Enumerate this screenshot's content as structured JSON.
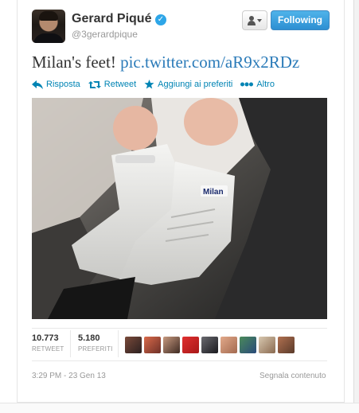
{
  "tweet": {
    "user": {
      "display_name": "Gerard Piqué",
      "screen_name": "@3gerardpique",
      "verified": true
    },
    "buttons": {
      "follow_label": "Following",
      "user_menu_icon": "user-dropdown-icon"
    },
    "text": {
      "body": "Milan's feet!",
      "link": "pic.twitter.com/aR9x2RDz"
    },
    "actions": [
      {
        "label": "Risposta",
        "icon": "reply-icon"
      },
      {
        "label": "Retweet",
        "icon": "retweet-icon"
      },
      {
        "label": "Aggiungi ai preferiti",
        "icon": "star-icon"
      },
      {
        "label": "Altro",
        "icon": "more-icon"
      }
    ],
    "stats": {
      "retweets": {
        "value": "10.773",
        "label": "RETWEET"
      },
      "favorites": {
        "value": "5.180",
        "label": "PREFERITI"
      }
    },
    "timestamp": "3:29 PM - 23 Gen 13",
    "report_label": "Segnala contenuto"
  },
  "colors": {
    "link": "#2b7bb9",
    "action": "#0084b4",
    "follow_button": "#2d8fd2",
    "verified": "#2ea6e8"
  }
}
